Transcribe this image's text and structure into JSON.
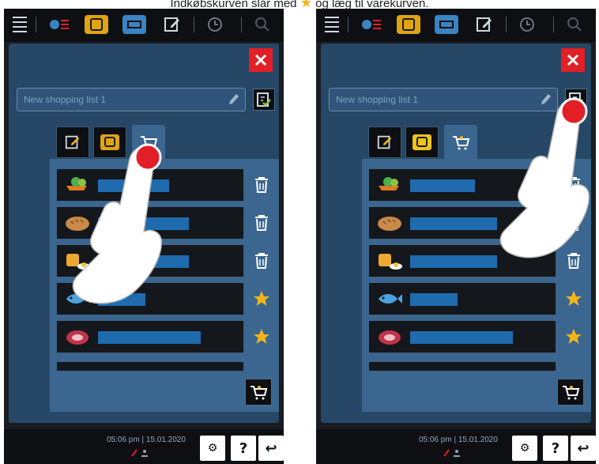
{
  "caption": {
    "text_before_star": "Indkøbskurven slår med",
    "text_after_star": "og læg til varekurven."
  },
  "screens": [
    {
      "name_placeholder": "New shopping list 1",
      "time": "05:06 pm",
      "date": "15.01.2020",
      "items": [
        {
          "icon": "vegetables-icon",
          "action": "trash-icon"
        },
        {
          "icon": "bread-icon",
          "action": "trash-icon"
        },
        {
          "icon": "dessert-icon",
          "action": "trash-icon"
        },
        {
          "icon": "fish-icon",
          "action": "star-icon"
        },
        {
          "icon": "meat-icon",
          "action": "star-icon"
        }
      ]
    },
    {
      "name_placeholder": "New shopping list 1",
      "time": "05:06 pm",
      "date": "15.01.2020",
      "items": [
        {
          "icon": "vegetables-icon",
          "action": "trash-icon"
        },
        {
          "icon": "bread-icon",
          "action": "trash-icon"
        },
        {
          "icon": "dessert-icon",
          "action": "trash-icon"
        },
        {
          "icon": "fish-icon",
          "action": "star-icon"
        },
        {
          "icon": "meat-icon",
          "action": "star-icon"
        }
      ]
    }
  ],
  "buttons": {
    "help": "?",
    "settings": "⚙",
    "back": "↩"
  },
  "colors": {
    "accent_red": "#e21f26",
    "panel_blue": "#264766",
    "row_highlight": "#1f6bae",
    "star_yellow": "#f4b41a"
  }
}
